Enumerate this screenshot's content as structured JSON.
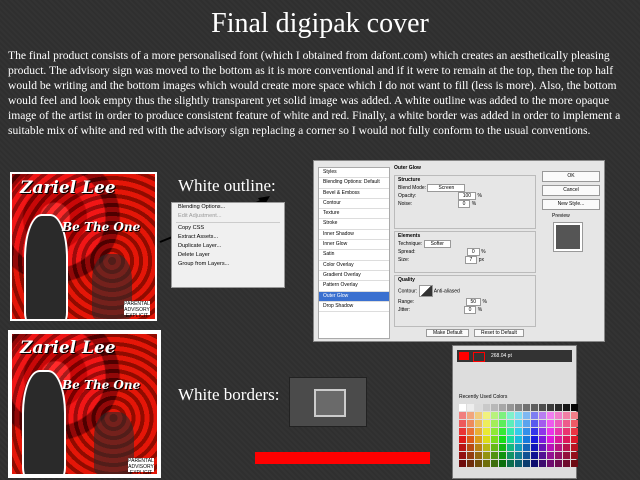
{
  "title": "Final digipak cover",
  "body": "The final product consists of a more personalised font (which I obtained from dafont.com) which creates an aesthetically pleasing product. The advisory sign was moved to the bottom as it is more conventional and if it were to remain at the top, then the top half would be writing and the bottom images which would create more space which I do not want to fill (less is more). Also, the bottom would feel and look empty thus the slightly transparent yet solid image was added. A white outline was added to the more opaque image of the artist in order to produce  consistent feature of white and red. Finally, a white border was added in order to implement a suitable mix of white and red with the advisory sign replacing a corner so I would not fully conform to the usual conventions.",
  "labels": {
    "outline": "White outline:",
    "borders": "White borders:"
  },
  "cover": {
    "artist": "Zariel Lee",
    "album": "Be The One",
    "advisory": "PARENTAL ADVISORY EXPLICIT CONTENT"
  },
  "context_menu": [
    "Blending Options...",
    "Edit Adjustment...",
    "Copy CSS",
    "Extract Assets...",
    "Duplicate Layer...",
    "Delete Layer",
    "Group from Layers..."
  ],
  "layer_style": {
    "styles": [
      "Styles",
      "Blending Options: Default",
      "Bevel & Emboss",
      "Contour",
      "Texture",
      "Stroke",
      "Inner Shadow",
      "Inner Glow",
      "Satin",
      "Color Overlay",
      "Gradient Overlay",
      "Pattern Overlay",
      "Outer Glow",
      "Drop Shadow"
    ],
    "selected": "Outer Glow",
    "section_title": "Outer Glow",
    "structure": "Structure",
    "blend_mode_label": "Blend Mode:",
    "blend_mode": "Screen",
    "opacity_label": "Opacity:",
    "opacity": "100",
    "noise_label": "Noise:",
    "noise": "0",
    "elements": "Elements",
    "technique_label": "Technique:",
    "technique": "Softer",
    "spread_label": "Spread:",
    "spread": "0",
    "size_label": "Size:",
    "size": "7",
    "size_unit": "px",
    "quality": "Quality",
    "contour_label": "Contour:",
    "antialiased": "Anti-aliased",
    "range_label": "Range:",
    "range": "50",
    "jitter_label": "Jitter:",
    "jitter": "0",
    "make_default": "Make Default",
    "reset_default": "Reset to Default",
    "ok": "OK",
    "cancel": "Cancel",
    "new_style": "New Style...",
    "preview": "Preview"
  },
  "swatches": {
    "stroke_size": "268.04 pt",
    "recent": "Recently Used Colors"
  },
  "colors": {
    "accent_red": "#ff0000",
    "highlight": "#3a70d0"
  }
}
